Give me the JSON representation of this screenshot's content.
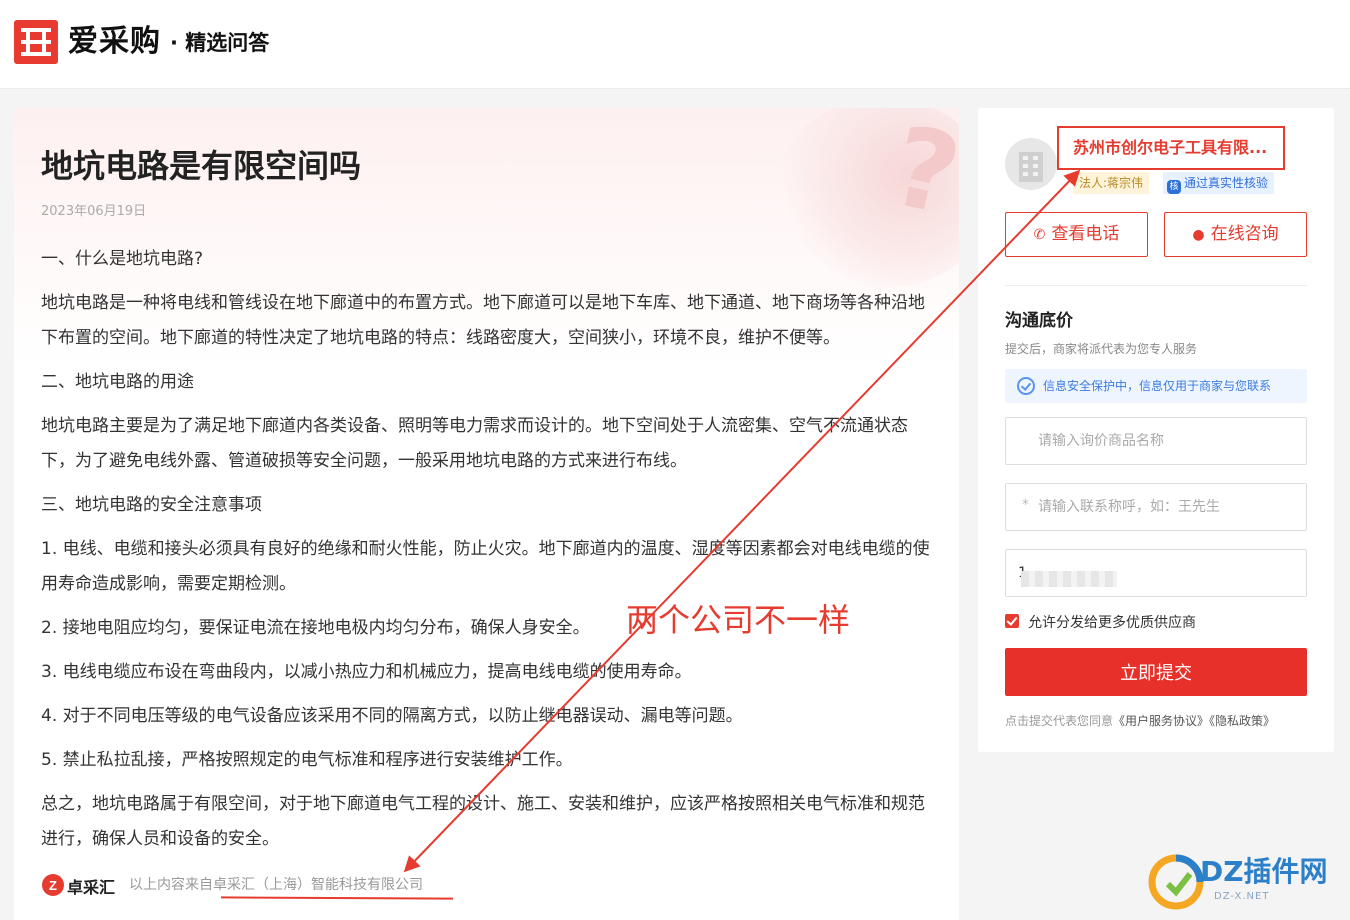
{
  "header": {
    "brand_name": "爱采购",
    "brand_sub": "· 精选问答"
  },
  "article": {
    "title": "地坑电路是有限空间吗",
    "date": "2023年06月19日",
    "paragraphs": [
      "一、什么是地坑电路?",
      "地坑电路是一种将电线和管线设在地下廊道中的布置方式。地下廊道可以是地下车库、地下通道、地下商场等各种沿地下布置的空间。地下廊道的特性决定了地坑电路的特点：线路密度大，空间狭小，环境不良，维护不便等。",
      "二、地坑电路的用途",
      "地坑电路主要是为了满足地下廊道内各类设备、照明等电力需求而设计的。地下空间处于人流密集、空气不流通状态下，为了避免电线外露、管道破损等安全问题，一般采用地坑电路的方式来进行布线。",
      "三、地坑电路的安全注意事项",
      "1. 电线、电缆和接头必须具有良好的绝缘和耐火性能，防止火灾。地下廊道内的温度、湿度等因素都会对电线电缆的使用寿命造成影响，需要定期检测。",
      "2. 接地电阻应均匀，要保证电流在接地电极内均匀分布，确保人身安全。",
      "3. 电线电缆应布设在弯曲段内，以减小热应力和机械应力，提高电线电缆的使用寿命。",
      "4. 对于不同电压等级的电气设备应该采用不同的隔离方式，以防止继电器误动、漏电等问题。",
      "5. 禁止私拉乱接，严格按照规定的电气标准和程序进行安装维护工作。",
      "总之，地坑电路属于有限空间，对于地下廊道电气工程的设计、施工、安装和维护，应该严格按照相关电气标准和规范进行，确保人员和设备的安全。"
    ],
    "source_logo": "卓采汇",
    "source_text": "以上内容来自卓采汇（上海）智能科技有限公司"
  },
  "sidebar": {
    "company_name": "苏州市创尔电子工具有限...",
    "legal_tag": "法人:蒋宗伟",
    "verify_tag": "通过真实性核验",
    "verify_icon": "核",
    "view_phone_label": "查看电话",
    "consult_label": "在线咨询",
    "section_title": "沟通底价",
    "section_sub": "提交后，商家将派代表为您专人服务",
    "security_notice": "信息安全保护中，信息仅用于商家与您联系",
    "product_placeholder": "请输入询价商品名称",
    "contact_placeholder": "请输入联系称呼，如：王先生",
    "phone_prefix": "1",
    "allow_distribute_label": "允许分发给更多优质供应商",
    "submit_label": "立即提交",
    "agree_prefix": "点击提交代表您同意",
    "agree_service": "《用户服务协议》",
    "agree_privacy": "《隐私政策》"
  },
  "annotation": {
    "text": "两个公司不一样",
    "color": "#e63c30"
  },
  "watermark": {
    "text": "DZ插件网",
    "url": "DZ-X.NET"
  },
  "colors": {
    "brand_red": "#e8302a",
    "accent_blue": "#2e6fd8"
  }
}
